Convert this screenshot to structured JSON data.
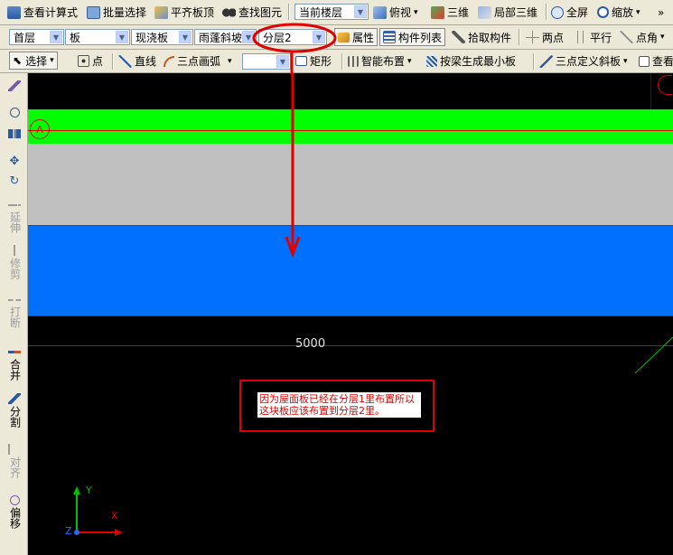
{
  "toolbar1": {
    "view_formula": "查看计算式",
    "batch_select": "批量选择",
    "align_slab_top": "平齐板顶",
    "find_element": "查找图元",
    "floor_scope": "当前楼层",
    "top_view": "俯视",
    "three_d": "三维",
    "local_3d": "局部三维",
    "fullscreen": "全屏",
    "zoom": "缩放"
  },
  "toolbar2": {
    "floor": "首层",
    "category": "板",
    "component_type": "现浇板",
    "component": "雨蓬斜坡1",
    "layer": "分层2",
    "properties": "属性",
    "component_list": "构件列表",
    "pick_component": "拾取构件",
    "two_points": "两点",
    "parallel": "平行",
    "point_angle": "点角"
  },
  "toolbar3": {
    "select": "选择",
    "point": "点",
    "line": "直线",
    "three_point_arc": "三点画弧",
    "rectangle": "矩形",
    "smart_layout": "智能布置",
    "generate_min_slab": "按梁生成最小板",
    "three_point_slope": "三点定义斜板",
    "view": "查看"
  },
  "left_tools": {
    "extend": "延伸",
    "trim": "修剪",
    "break": "打断",
    "merge": "合并",
    "split": "分割",
    "align": "对齐",
    "offset": "偏移"
  },
  "canvas": {
    "dimension": "5000",
    "axis_label": "A",
    "annotation": "因为屋面板已经在分层1里布置所以这块板应该布置到分层2里。",
    "y_axis": "Y",
    "x_axis": "X",
    "z_axis": "Z"
  },
  "colors": {
    "green_band": "#00ff00",
    "gray_band": "#c0c0c0",
    "blue_band": "#0070ff",
    "annotation_red": "#e00000"
  }
}
